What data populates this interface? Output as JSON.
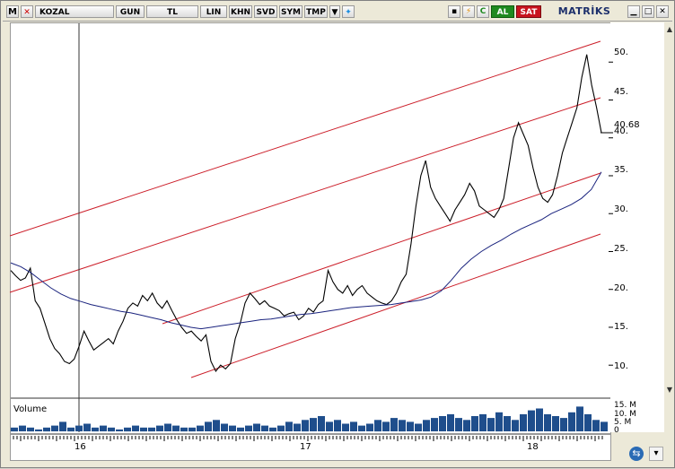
{
  "toolbar": {
    "logo": "M",
    "symbol": "KOZAL",
    "period": "GUN",
    "currency": "TL",
    "scale": "LIN",
    "buttons": [
      "KHN",
      "SVD",
      "SYM",
      "TMP"
    ],
    "buy": "AL",
    "sell": "SAT",
    "brand": "MATRİKS",
    "c_label": "C"
  },
  "chart": {
    "last_price": "40.68",
    "y_ticks": [
      "50.",
      "45.",
      "40.",
      "35.",
      "30.",
      "25.",
      "20.",
      "15.",
      "10."
    ],
    "volume_label": "Volume",
    "volume_ticks": [
      "15. M",
      "10. M",
      "5. M",
      "0"
    ],
    "x_labels": [
      "16",
      "17",
      "18"
    ]
  },
  "chart_data": {
    "type": "line",
    "title": "",
    "series_name": "",
    "ylim": [
      6,
      55
    ],
    "price": [
      22.5,
      21.8,
      21.2,
      21.5,
      22.8,
      18.5,
      17.5,
      15.5,
      13.5,
      12.2,
      11.5,
      10.5,
      10.2,
      10.8,
      12.5,
      14.5,
      13.2,
      12.0,
      12.5,
      13.0,
      13.5,
      12.8,
      14.5,
      15.8,
      17.5,
      18.2,
      17.8,
      19.2,
      18.5,
      19.5,
      18.2,
      17.5,
      18.5,
      17.2,
      16.0,
      15.0,
      14.2,
      14.5,
      13.8,
      13.2,
      14.0,
      10.5,
      9.2,
      10.0,
      9.5,
      10.2,
      13.5,
      15.5,
      18.2,
      19.5,
      18.8,
      18.0,
      18.5,
      17.8,
      17.5,
      17.2,
      16.5,
      16.8,
      17.0,
      16.0,
      16.5,
      17.5,
      17.0,
      18.0,
      18.5,
      22.5,
      21.0,
      20.0,
      19.5,
      20.5,
      19.2,
      20.0,
      20.5,
      19.5,
      19.0,
      18.5,
      18.2,
      18.0,
      18.5,
      19.5,
      21.0,
      22.0,
      26.0,
      31.0,
      35.0,
      37.0,
      33.5,
      32.0,
      31.0,
      30.0,
      29.0,
      30.5,
      31.5,
      32.5,
      34.0,
      33.0,
      31.0,
      30.5,
      30.0,
      29.5,
      30.5,
      32.0,
      36.0,
      40.0,
      42.0,
      40.5,
      39.0,
      36.0,
      33.5,
      32.0,
      31.5,
      32.5,
      35.0,
      38.0,
      40.0,
      42.0,
      44.0,
      48.0,
      51.0,
      47.0,
      44.0,
      40.68
    ],
    "moving_average": [
      23.5,
      23.0,
      22.2,
      21.2,
      20.2,
      19.4,
      18.8,
      18.4,
      18.0,
      17.7,
      17.4,
      17.1,
      16.9,
      16.6,
      16.3,
      16.0,
      15.6,
      15.3,
      15.0,
      14.8,
      15.0,
      15.2,
      15.4,
      15.6,
      15.8,
      16.0,
      16.1,
      16.3,
      16.5,
      16.7,
      16.8,
      17.0,
      17.2,
      17.4,
      17.6,
      17.7,
      17.8,
      17.9,
      18.0,
      18.2,
      18.4,
      18.6,
      19.0,
      19.8,
      21.2,
      22.8,
      24.0,
      25.0,
      25.8,
      26.5,
      27.3,
      28.0,
      28.6,
      29.2,
      30.0,
      30.6,
      31.2,
      32.0,
      33.2,
      35.5
    ],
    "volume": [
      2,
      3,
      2,
      1,
      2,
      3,
      5,
      2,
      3,
      4,
      2,
      3,
      2,
      1,
      2,
      3,
      2,
      2,
      3,
      4,
      3,
      2,
      2,
      3,
      5,
      6,
      4,
      3,
      2,
      3,
      4,
      3,
      2,
      3,
      5,
      4,
      6,
      7,
      8,
      5,
      6,
      4,
      5,
      3,
      4,
      6,
      5,
      7,
      6,
      5,
      4,
      6,
      7,
      8,
      9,
      7,
      6,
      8,
      9,
      7,
      10,
      8,
      6,
      9,
      11,
      12,
      9,
      8,
      7,
      10,
      13,
      9,
      6,
      5
    ]
  }
}
